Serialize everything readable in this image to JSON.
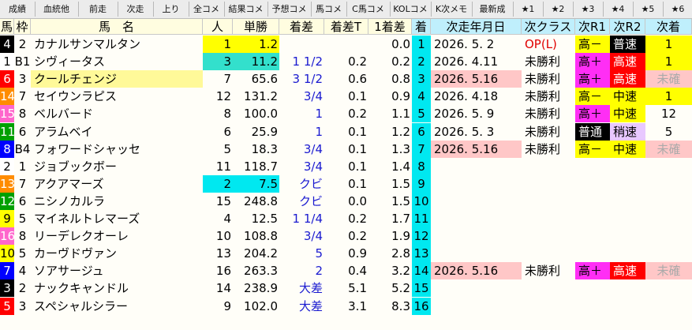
{
  "toolbar": [
    "成績",
    "血統他",
    "前走",
    "次走",
    "上り",
    "全コメ",
    "結果コメ",
    "予想コメ",
    "馬コメ",
    "C馬コメ",
    "KOLコメ",
    "K次メモ",
    "最新成",
    "★1",
    "★2",
    "★3",
    "★4",
    "★5",
    "★6",
    "★"
  ],
  "headers": [
    "馬",
    "枠",
    "馬　名",
    "人",
    "単勝",
    "着差",
    "着差T",
    "1着差",
    "着",
    "次走年月日",
    "次クラス",
    "次R1",
    "次R2",
    "次着"
  ],
  "colors": {
    "frame1": "#ffffff",
    "frame2": "#000000",
    "frame3": "#ff0000",
    "frame4": "#0000ff",
    "frame5": "#ffff00",
    "frame6": "#00a000",
    "frame7": "#ff8c00",
    "frame8": "#ff66cc"
  },
  "rows": [
    {
      "uma": "4",
      "waku": "2",
      "name": "カナルサンマルタン",
      "ninki": "1",
      "tansho": "1.2",
      "chakusa": "",
      "chakusaT": "",
      "ichisa": "0.0",
      "chaku": "1",
      "next_date": "2026. 5. 2",
      "next_class": "OP(L)",
      "r1": "高－",
      "r2": "普速",
      "next_chaku": "1"
    },
    {
      "uma": "1",
      "waku": "B1",
      "name": "シヴィータス",
      "ninki": "3",
      "tansho": "11.2",
      "chakusa": "1 1/2",
      "chakusaT": "0.2",
      "ichisa": "0.2",
      "chaku": "2",
      "next_date": "2026. 4.11",
      "next_class": "未勝利",
      "r1": "高＋",
      "r2": "高速",
      "next_chaku": "1"
    },
    {
      "uma": "6",
      "waku": "3",
      "name": "クールチェンジ",
      "ninki": "7",
      "tansho": "65.6",
      "chakusa": "3 1/2",
      "chakusaT": "0.6",
      "ichisa": "0.8",
      "chaku": "3",
      "next_date": "2026. 5.16",
      "next_class": "未勝利",
      "r1": "高＋",
      "r2": "高速",
      "next_chaku": "未確"
    },
    {
      "uma": "14",
      "waku": "7",
      "name": "セイウンラピス",
      "ninki": "12",
      "tansho": "131.2",
      "chakusa": "3/4",
      "chakusaT": "0.1",
      "ichisa": "0.9",
      "chaku": "4",
      "next_date": "2026. 4.18",
      "next_class": "未勝利",
      "r1": "高－",
      "r2": "中速",
      "next_chaku": "1"
    },
    {
      "uma": "15",
      "waku": "8",
      "name": "ベルバード",
      "ninki": "8",
      "tansho": "100.0",
      "chakusa": "1",
      "chakusaT": "0.2",
      "ichisa": "1.1",
      "chaku": "5",
      "next_date": "2026. 5. 9",
      "next_class": "未勝利",
      "r1": "高＋",
      "r2": "中速",
      "next_chaku": "12"
    },
    {
      "uma": "11",
      "waku": "6",
      "name": "アラムベイ",
      "ninki": "6",
      "tansho": "25.9",
      "chakusa": "1",
      "chakusaT": "0.1",
      "ichisa": "1.2",
      "chaku": "6",
      "next_date": "2026. 5. 3",
      "next_class": "未勝利",
      "r1": "普通",
      "r2": "稍速",
      "next_chaku": "5"
    },
    {
      "uma": "8",
      "waku": "B4",
      "name": "フォワードシャッセ",
      "ninki": "5",
      "tansho": "18.3",
      "chakusa": "3/4",
      "chakusaT": "0.1",
      "ichisa": "1.3",
      "chaku": "7",
      "next_date": "2026. 5.16",
      "next_class": "未勝利",
      "r1": "高－",
      "r2": "中速",
      "next_chaku": "未確"
    },
    {
      "uma": "2",
      "waku": "1",
      "name": "ジョブックボー",
      "ninki": "11",
      "tansho": "118.7",
      "chakusa": "3/4",
      "chakusaT": "0.1",
      "ichisa": "1.4",
      "chaku": "8",
      "next_date": "",
      "next_class": "",
      "r1": "",
      "r2": "",
      "next_chaku": ""
    },
    {
      "uma": "13",
      "waku": "7",
      "name": "アクアマーズ",
      "ninki": "2",
      "tansho": "7.5",
      "chakusa": "クビ",
      "chakusaT": "0.1",
      "ichisa": "1.5",
      "chaku": "9",
      "next_date": "",
      "next_class": "",
      "r1": "",
      "r2": "",
      "next_chaku": ""
    },
    {
      "uma": "12",
      "waku": "6",
      "name": "ニシノカルラ",
      "ninki": "15",
      "tansho": "248.8",
      "chakusa": "クビ",
      "chakusaT": "0.0",
      "ichisa": "1.5",
      "chaku": "10",
      "next_date": "",
      "next_class": "",
      "r1": "",
      "r2": "",
      "next_chaku": ""
    },
    {
      "uma": "9",
      "waku": "5",
      "name": "マイネルトレマーズ",
      "ninki": "4",
      "tansho": "12.5",
      "chakusa": "1 1/4",
      "chakusaT": "0.2",
      "ichisa": "1.7",
      "chaku": "11",
      "next_date": "",
      "next_class": "",
      "r1": "",
      "r2": "",
      "next_chaku": ""
    },
    {
      "uma": "16",
      "waku": "8",
      "name": "リーデレクオーレ",
      "ninki": "10",
      "tansho": "108.8",
      "chakusa": "3/4",
      "chakusaT": "0.2",
      "ichisa": "1.9",
      "chaku": "12",
      "next_date": "",
      "next_class": "",
      "r1": "",
      "r2": "",
      "next_chaku": ""
    },
    {
      "uma": "10",
      "waku": "5",
      "name": "カーヴドヴァン",
      "ninki": "13",
      "tansho": "204.2",
      "chakusa": "5",
      "chakusaT": "0.9",
      "ichisa": "2.8",
      "chaku": "13",
      "next_date": "",
      "next_class": "",
      "r1": "",
      "r2": "",
      "next_chaku": ""
    },
    {
      "uma": "7",
      "waku": "4",
      "name": "ソアサージュ",
      "ninki": "16",
      "tansho": "263.3",
      "chakusa": "2",
      "chakusaT": "0.4",
      "ichisa": "3.2",
      "chaku": "14",
      "next_date": "2026. 5.16",
      "next_class": "未勝利",
      "r1": "高＋",
      "r2": "高速",
      "next_chaku": "未確"
    },
    {
      "uma": "3",
      "waku": "2",
      "name": "ナックキャンドル",
      "ninki": "14",
      "tansho": "238.9",
      "chakusa": "大差",
      "chakusaT": "5.1",
      "ichisa": "5.2",
      "chaku": "15",
      "next_date": "",
      "next_class": "",
      "r1": "",
      "r2": "",
      "next_chaku": ""
    },
    {
      "uma": "5",
      "waku": "3",
      "name": "スペシャルシラー",
      "ninki": "9",
      "tansho": "102.0",
      "chakusa": "大差",
      "chakusaT": "3.1",
      "ichisa": "8.3",
      "chaku": "16",
      "next_date": "",
      "next_class": "",
      "r1": "",
      "r2": "",
      "next_chaku": ""
    }
  ]
}
